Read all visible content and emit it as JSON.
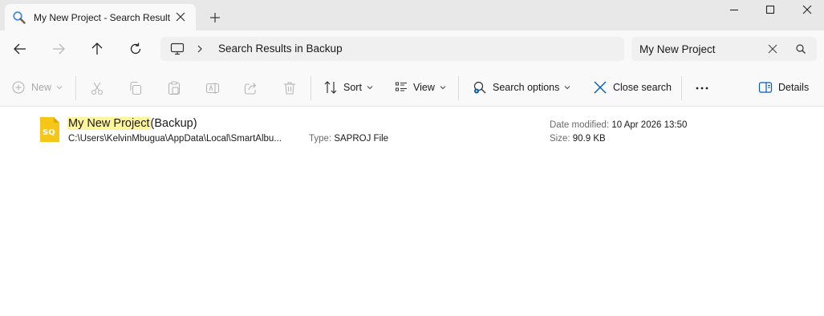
{
  "tab": {
    "title": "My New Project - Search Results in Backup",
    "icon": "search-icon"
  },
  "address": {
    "location": "Search Results in Backup",
    "root_icon": "this-pc-icon"
  },
  "search": {
    "value": "My New Project"
  },
  "commands": {
    "new_label": "New",
    "sort_label": "Sort",
    "view_label": "View",
    "search_options_label": "Search options",
    "close_search_label": "Close search",
    "details_label": "Details"
  },
  "results": [
    {
      "name_match": "My New Project",
      "name_rest": "(Backup)",
      "path": "C:\\Users\\KelvinMbugua\\AppData\\Local\\SmartAlbu...",
      "type_label": "Type:",
      "type_value": "SAPROJ File",
      "date_label": "Date modified:",
      "date_value": "10 Apr 2026 13:50",
      "size_label": "Size:",
      "size_value": "90.9 KB",
      "icon_text": "SQ",
      "icon_color": "#f5c518"
    }
  ],
  "colors": {
    "accent": "#005fb8",
    "highlight": "#fff59d"
  }
}
